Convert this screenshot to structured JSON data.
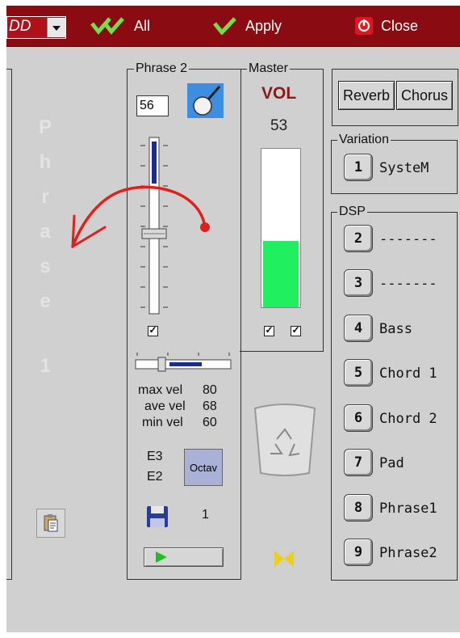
{
  "toolbar": {
    "combo_text": "DD",
    "all_label": "All",
    "apply_label": "Apply",
    "close_label": "Close"
  },
  "left_panel": {
    "letters": [
      "P",
      "h",
      "r",
      "a",
      "s",
      "e",
      "1"
    ]
  },
  "phrase2": {
    "group_label": "Phrase 2",
    "value_input": "56",
    "max_vel_label": "max vel",
    "max_vel": "80",
    "ave_vel_label": "ave vel",
    "ave_vel": "68",
    "min_vel_label": "min vel",
    "min_vel": "60",
    "note_high": "E3",
    "note_low": "E2",
    "octave_button": "Octav",
    "save_count": "1"
  },
  "master": {
    "group_label": "Master",
    "vol_label": "VOL",
    "vol_value": "53",
    "level_fraction": 0.42
  },
  "effects": {
    "reverb_label": "Reverb",
    "chorus_label": "Chorus"
  },
  "variation": {
    "group_label": "Variation",
    "item": {
      "number": "1",
      "label": "SysteM"
    }
  },
  "dsp": {
    "group_label": "DSP",
    "items": [
      {
        "number": "2",
        "label": "-------"
      },
      {
        "number": "3",
        "label": "-------"
      },
      {
        "number": "4",
        "label": "Bass"
      },
      {
        "number": "5",
        "label": "Chord 1"
      },
      {
        "number": "6",
        "label": "Chord 2"
      },
      {
        "number": "7",
        "label": "Pad"
      },
      {
        "number": "8",
        "label": "Phrase1"
      },
      {
        "number": "9",
        "label": "Phrase2"
      }
    ]
  },
  "colors": {
    "toolbar_bg": "#8a0c12",
    "vol_red": "#8b1a1a",
    "level_green": "#20f060",
    "annotation_red": "#e0201c"
  }
}
